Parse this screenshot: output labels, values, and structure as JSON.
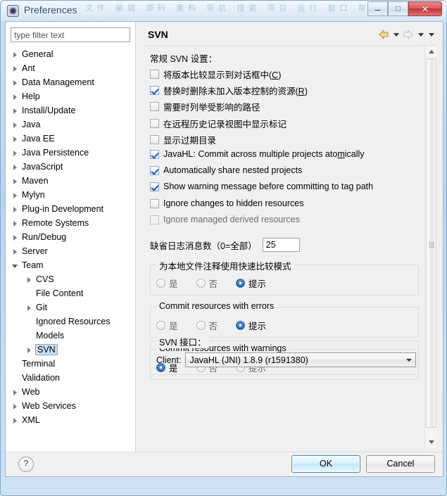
{
  "window": {
    "title": "Preferences",
    "ghost_menu": "文件  编辑  源码  重构  导航  搜索  项目  运行  窗口  帮助",
    "minimize_label": "–",
    "maximize_label": "□",
    "close_label": "✕"
  },
  "sidebar": {
    "filter_placeholder": "type filter text",
    "filter_value": "",
    "items": [
      {
        "label": "General",
        "indent": 0,
        "state": "collapsed",
        "selected": false
      },
      {
        "label": "Ant",
        "indent": 0,
        "state": "collapsed",
        "selected": false
      },
      {
        "label": "Data Management",
        "indent": 0,
        "state": "collapsed",
        "selected": false
      },
      {
        "label": "Help",
        "indent": 0,
        "state": "collapsed",
        "selected": false
      },
      {
        "label": "Install/Update",
        "indent": 0,
        "state": "collapsed",
        "selected": false
      },
      {
        "label": "Java",
        "indent": 0,
        "state": "collapsed",
        "selected": false
      },
      {
        "label": "Java EE",
        "indent": 0,
        "state": "collapsed",
        "selected": false
      },
      {
        "label": "Java Persistence",
        "indent": 0,
        "state": "collapsed",
        "selected": false
      },
      {
        "label": "JavaScript",
        "indent": 0,
        "state": "collapsed",
        "selected": false
      },
      {
        "label": "Maven",
        "indent": 0,
        "state": "collapsed",
        "selected": false
      },
      {
        "label": "Mylyn",
        "indent": 0,
        "state": "collapsed",
        "selected": false
      },
      {
        "label": "Plug-in Development",
        "indent": 0,
        "state": "collapsed",
        "selected": false
      },
      {
        "label": "Remote Systems",
        "indent": 0,
        "state": "collapsed",
        "selected": false
      },
      {
        "label": "Run/Debug",
        "indent": 0,
        "state": "collapsed",
        "selected": false
      },
      {
        "label": "Server",
        "indent": 0,
        "state": "collapsed",
        "selected": false
      },
      {
        "label": "Team",
        "indent": 0,
        "state": "expanded",
        "selected": false
      },
      {
        "label": "CVS",
        "indent": 1,
        "state": "collapsed",
        "selected": false
      },
      {
        "label": "File Content",
        "indent": 1,
        "state": "none",
        "selected": false
      },
      {
        "label": "Git",
        "indent": 1,
        "state": "collapsed",
        "selected": false
      },
      {
        "label": "Ignored Resources",
        "indent": 1,
        "state": "none",
        "selected": false
      },
      {
        "label": "Models",
        "indent": 1,
        "state": "none",
        "selected": false
      },
      {
        "label": "SVN",
        "indent": 1,
        "state": "collapsed",
        "selected": true
      },
      {
        "label": "Terminal",
        "indent": 0,
        "state": "none",
        "selected": false
      },
      {
        "label": "Validation",
        "indent": 0,
        "state": "none",
        "selected": false
      },
      {
        "label": "Web",
        "indent": 0,
        "state": "collapsed",
        "selected": false
      },
      {
        "label": "Web Services",
        "indent": 0,
        "state": "collapsed",
        "selected": false
      },
      {
        "label": "XML",
        "indent": 0,
        "state": "collapsed",
        "selected": false
      }
    ]
  },
  "page": {
    "title": "SVN",
    "section_label": "常规 SVN 设置：",
    "checkboxes": [
      {
        "label": "将版本比较显示到对话框中(C)",
        "checked": false,
        "enabled": true,
        "mnemonic": "C"
      },
      {
        "label": "替换时删除未加入版本控制的资源(R)",
        "checked": true,
        "enabled": true,
        "mnemonic": "R"
      },
      {
        "label": "需要时列举受影响的路径",
        "checked": false,
        "enabled": true,
        "mnemonic": ""
      },
      {
        "label": "在远程历史记录视图中显示标记",
        "checked": false,
        "enabled": true,
        "mnemonic": ""
      },
      {
        "label": "显示过期目录",
        "checked": false,
        "enabled": true,
        "mnemonic": ""
      },
      {
        "label": "JavaHL: Commit across multiple projects atomically",
        "checked": true,
        "enabled": true,
        "mnemonic": "m"
      },
      {
        "label": "Automatically share nested projects",
        "checked": true,
        "enabled": true,
        "mnemonic": ""
      },
      {
        "label": "Show warning message before committing to tag path",
        "checked": true,
        "enabled": true,
        "mnemonic": ""
      },
      {
        "label": "Ignore changes to hidden resources",
        "checked": false,
        "enabled": true,
        "mnemonic": ""
      },
      {
        "label": "Ignore managed derived resources",
        "checked": false,
        "enabled": false,
        "mnemonic": ""
      }
    ],
    "log_count": {
      "label": "缺省日志消息数（0=全部）",
      "value": "25"
    },
    "groups": [
      {
        "title": "为本地文件注释使用快速比较模式",
        "options": [
          {
            "label": "是",
            "selected": false,
            "enabled": false
          },
          {
            "label": "否",
            "selected": false,
            "enabled": false
          },
          {
            "label": "提示",
            "selected": true,
            "enabled": true
          }
        ]
      },
      {
        "title": "Commit resources with errors",
        "options": [
          {
            "label": "是",
            "selected": false,
            "enabled": false
          },
          {
            "label": "否",
            "selected": false,
            "enabled": false
          },
          {
            "label": "提示",
            "selected": true,
            "enabled": true
          }
        ]
      },
      {
        "title": "Commit resources with warnings",
        "options": [
          {
            "label": "是",
            "selected": true,
            "enabled": true
          },
          {
            "label": "否",
            "selected": false,
            "enabled": false
          },
          {
            "label": "提示",
            "selected": false,
            "enabled": false
          }
        ]
      }
    ],
    "svn_interface": {
      "title": "SVN 接口：",
      "client_label": "Client:",
      "client_value": "JavaHL (JNI) 1.8.9 (r1591380)"
    },
    "nav": {
      "back_icon": "back-arrow-icon",
      "back_enabled": true,
      "forward_icon": "forward-arrow-icon",
      "forward_enabled": false
    }
  },
  "footer": {
    "help_label": "?",
    "ok_label": "OK",
    "cancel_label": "Cancel"
  }
}
